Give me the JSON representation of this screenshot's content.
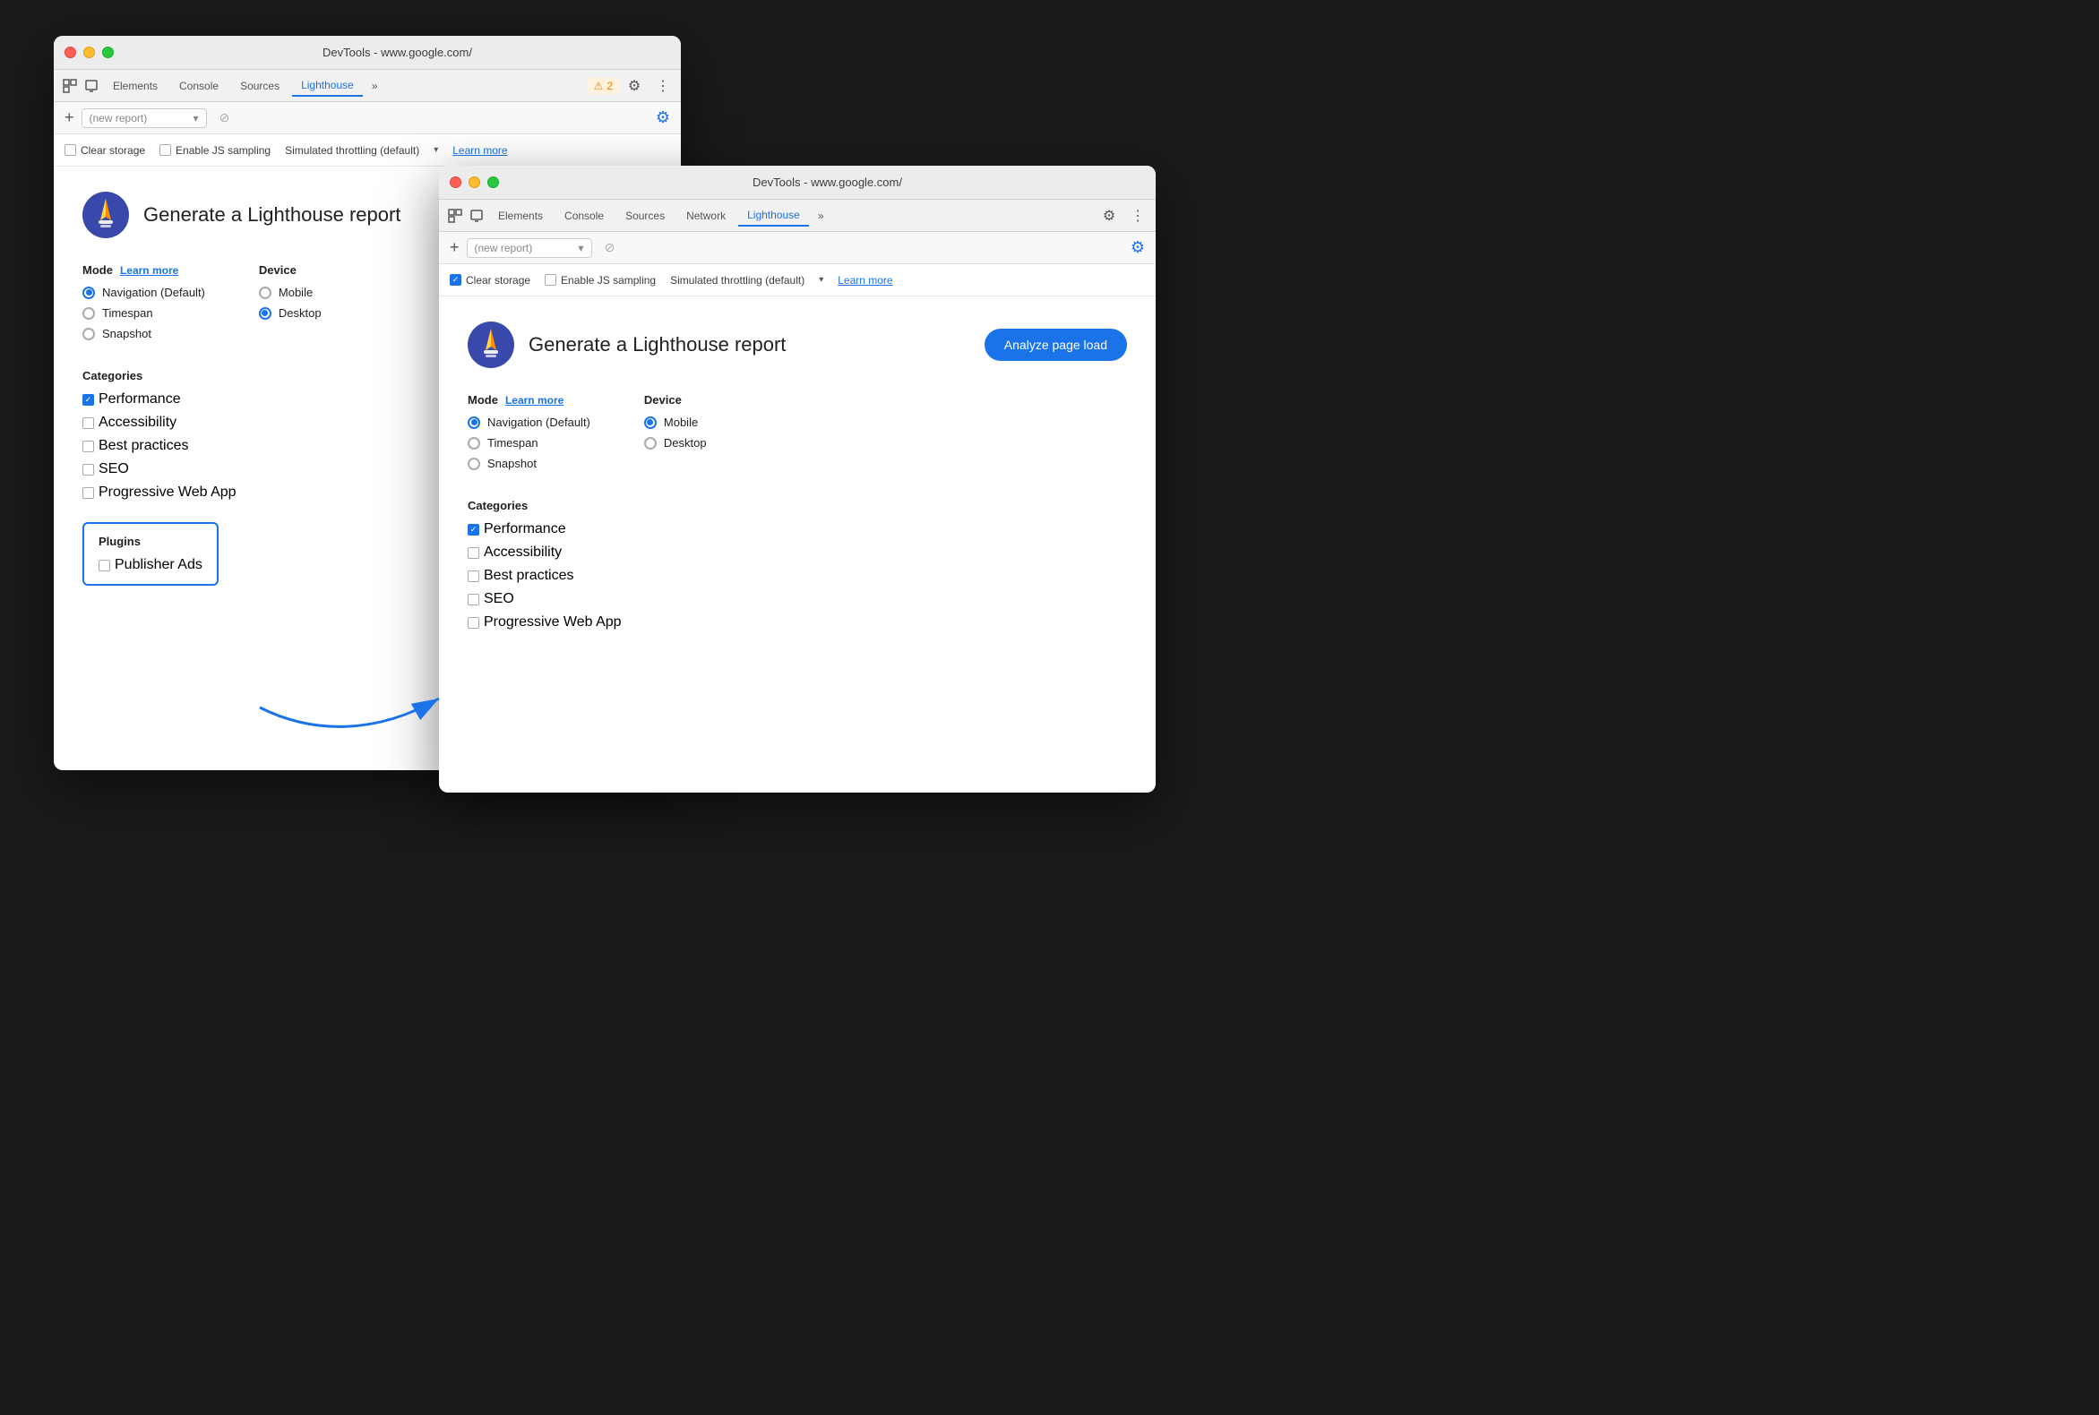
{
  "window_back": {
    "title": "DevTools - www.google.com/",
    "tabs": [
      "Elements",
      "Console",
      "Sources",
      "Lighthouse",
      ">>"
    ],
    "active_tab": "Lighthouse",
    "warning_count": "2",
    "report_placeholder": "(new report)",
    "options": {
      "clear_storage": false,
      "enable_js_sampling": false,
      "throttling": "Simulated throttling (default)",
      "learn_more": "Learn more"
    },
    "report_title": "Generate a Lighthouse report",
    "mode_label": "Mode",
    "learn_more": "Learn more",
    "device_label": "Device",
    "modes": [
      {
        "label": "Navigation (Default)",
        "selected": true
      },
      {
        "label": "Timespan",
        "selected": false
      },
      {
        "label": "Snapshot",
        "selected": false
      }
    ],
    "devices": [
      {
        "label": "Mobile",
        "selected": false
      },
      {
        "label": "Desktop",
        "selected": true
      }
    ],
    "categories_label": "Categories",
    "categories": [
      {
        "label": "Performance",
        "checked": true
      },
      {
        "label": "Accessibility",
        "checked": false
      },
      {
        "label": "Best practices",
        "checked": false
      },
      {
        "label": "SEO",
        "checked": false
      },
      {
        "label": "Progressive Web App",
        "checked": false
      }
    ],
    "plugins_label": "Plugins",
    "plugins": [
      {
        "label": "Publisher Ads",
        "checked": false
      }
    ]
  },
  "window_front": {
    "title": "DevTools - www.google.com/",
    "tabs": [
      "Elements",
      "Console",
      "Sources",
      "Network",
      "Lighthouse",
      ">>"
    ],
    "active_tab": "Lighthouse",
    "report_placeholder": "(new report)",
    "options": {
      "clear_storage": true,
      "enable_js_sampling": false,
      "throttling": "Simulated throttling (default)",
      "learn_more": "Learn more"
    },
    "report_title": "Generate a Lighthouse report",
    "analyze_label": "Analyze page load",
    "mode_label": "Mode",
    "learn_more": "Learn more",
    "device_label": "Device",
    "modes": [
      {
        "label": "Navigation (Default)",
        "selected": true
      },
      {
        "label": "Timespan",
        "selected": false
      },
      {
        "label": "Snapshot",
        "selected": false
      }
    ],
    "devices": [
      {
        "label": "Mobile",
        "selected": true
      },
      {
        "label": "Desktop",
        "selected": false
      }
    ],
    "categories_label": "Categories",
    "categories": [
      {
        "label": "Performance",
        "checked": true
      },
      {
        "label": "Accessibility",
        "checked": false
      },
      {
        "label": "Best practices",
        "checked": false
      },
      {
        "label": "SEO",
        "checked": false
      },
      {
        "label": "Progressive Web App",
        "checked": false
      }
    ]
  },
  "arrow": {
    "label": "arrow pointing from plugins box to front window"
  }
}
